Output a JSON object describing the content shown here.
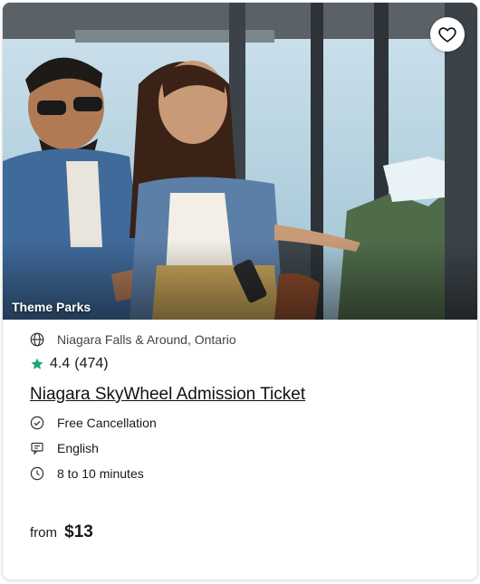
{
  "image": {
    "category_tag": "Theme Parks",
    "favorite_icon": "heart-outline-icon"
  },
  "details": {
    "location": "Niagara Falls & Around, Ontario",
    "rating": "4.4",
    "reviews": "(474)",
    "title": "Niagara SkyWheel Admission Ticket",
    "features": [
      {
        "icon": "check-circle-icon",
        "label": "Free Cancellation"
      },
      {
        "icon": "chat-bubble-icon",
        "label": "English"
      },
      {
        "icon": "clock-icon",
        "label": "8 to 10 minutes"
      }
    ]
  },
  "price": {
    "prefix": "from",
    "amount": "$13"
  },
  "colors": {
    "star": "#1aa873",
    "text": "#1a1a1a"
  }
}
